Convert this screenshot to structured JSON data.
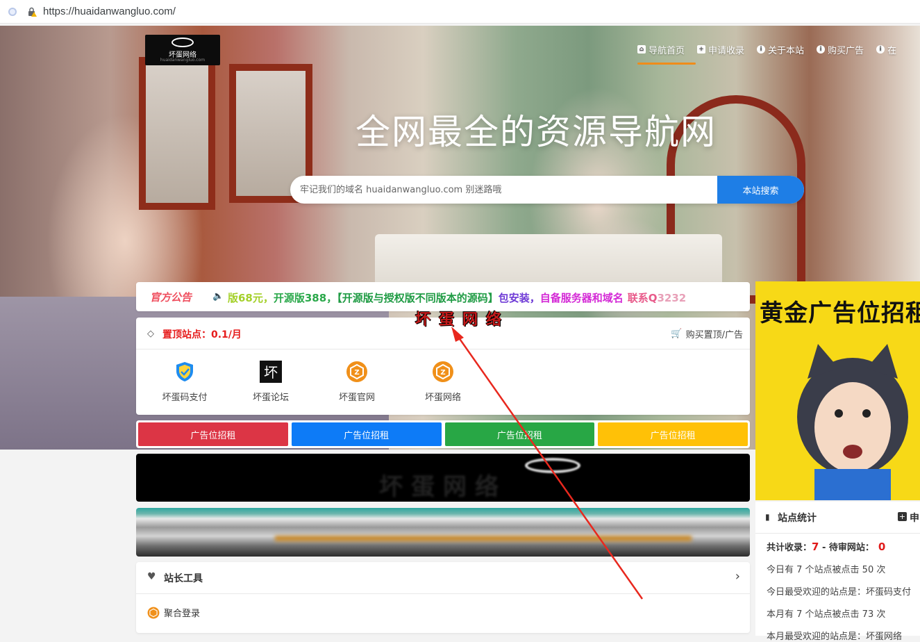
{
  "browser": {
    "url": "https://huaidanwangluo.com/"
  },
  "logo": {
    "text": "坏蛋网络",
    "sub": "huaidanwangluo.com"
  },
  "nav": {
    "items": [
      {
        "label": "导航首页",
        "icon": "home-icon"
      },
      {
        "label": "申请收录",
        "icon": "plus-square-icon"
      },
      {
        "label": "关于本站",
        "icon": "info-icon"
      },
      {
        "label": "购买广告",
        "icon": "info-icon"
      },
      {
        "label": "在",
        "icon": "info-icon"
      }
    ],
    "active_color": "#f08c1a"
  },
  "hero": {
    "title": "全网最全的资源导航网"
  },
  "search": {
    "placeholder": "牢记我们的域名 huaidanwangluo.com 别迷路哦",
    "button": "本站搜索"
  },
  "notice": {
    "badge": "官方公告",
    "parts": [
      {
        "text": "版68元，",
        "color": "#a4d02a"
      },
      {
        "text": "开源版388，",
        "color": "#2aa84a"
      },
      {
        "text": "【开源版与授权版不同版本的源码】",
        "color": "#1f9b44"
      },
      {
        "text": "包安装，",
        "color": "#6f3bd6"
      },
      {
        "text": "自备服务器和域名",
        "color": "#d42ad6"
      },
      {
        "text": "联系Q",
        "color": "#e85a8a"
      },
      {
        "text": "3232",
        "color": "#e8a0b8"
      }
    ]
  },
  "watermark": "坏蛋网络",
  "top_sites": {
    "title": "置顶站点：0.1/月",
    "buy": "购买置顶/广告",
    "items": [
      {
        "label": "坏蛋码支付",
        "icon": "shield-check-icon"
      },
      {
        "label": "坏蛋论坛",
        "icon": "huai-char-icon"
      },
      {
        "label": "坏蛋官网",
        "icon": "orange-hex-icon"
      },
      {
        "label": "坏蛋网络",
        "icon": "orange-hex-icon"
      }
    ]
  },
  "ads": [
    {
      "label": "广告位招租",
      "color": "#dc3545"
    },
    {
      "label": "广告位招租",
      "color": "#0d7bf7"
    },
    {
      "label": "广告位招租",
      "color": "#28a745"
    },
    {
      "label": "广告位招租",
      "color": "#ffc107"
    }
  ],
  "tools": {
    "title": "站长工具",
    "items": [
      {
        "label": "聚合登录",
        "icon": "orange-hex-icon"
      }
    ]
  },
  "side_ad": {
    "title": "黄金广告位招租"
  },
  "stats": {
    "title": "站点统计",
    "apply": "申",
    "total_label": "共计收录：",
    "total": "7",
    "sep": " - ",
    "pending_label": "待审网站：",
    "pending": "0",
    "line_today_clicks": "今日有 7 个站点被点击 50 次",
    "line_today_popular": "今日最受欢迎的站点是：坏蛋码支付",
    "line_month_clicks": "本月有 7 个站点被点击 73 次",
    "line_month_popular": "本月最受欢迎的站点是：坏蛋网络"
  }
}
